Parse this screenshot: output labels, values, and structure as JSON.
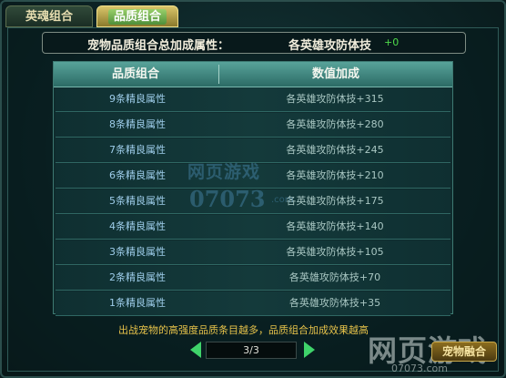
{
  "tabs": [
    {
      "label": "英魂组合",
      "active": false
    },
    {
      "label": "品质组合",
      "active": true
    }
  ],
  "summary": {
    "label": "宠物品质组合总加成属性：",
    "value": "各英雄攻防体技",
    "bonus": "+0"
  },
  "table": {
    "headers": [
      "品质组合",
      "数值加成"
    ],
    "rows": [
      {
        "combo": "9条精良属性",
        "bonus": "各英雄攻防体技+315"
      },
      {
        "combo": "8条精良属性",
        "bonus": "各英雄攻防体技+280"
      },
      {
        "combo": "7条精良属性",
        "bonus": "各英雄攻防体技+245"
      },
      {
        "combo": "6条精良属性",
        "bonus": "各英雄攻防体技+210"
      },
      {
        "combo": "5条精良属性",
        "bonus": "各英雄攻防体技+175"
      },
      {
        "combo": "4条精良属性",
        "bonus": "各英雄攻防体技+140"
      },
      {
        "combo": "3条精良属性",
        "bonus": "各英雄攻防体技+105"
      },
      {
        "combo": "2条精良属性",
        "bonus": "各英雄攻防体技+70"
      },
      {
        "combo": "1条精良属性",
        "bonus": "各英雄攻防体技+35"
      }
    ]
  },
  "note": "出战宠物的高强度品质条目越多，品质组合加成效果越高",
  "pager": {
    "text": "3/3"
  },
  "watermark_center": {
    "line1": "网页游戏",
    "line2": "07073",
    "line3": ".com"
  },
  "watermark_corner": {
    "line1": "网页游戏",
    "line2": "07073.com"
  },
  "button": {
    "label": "宠物融合"
  },
  "colors": {
    "accent_green": "#3fd36a",
    "note_gold": "#e6c24a",
    "header_teal": "#58a39a"
  }
}
